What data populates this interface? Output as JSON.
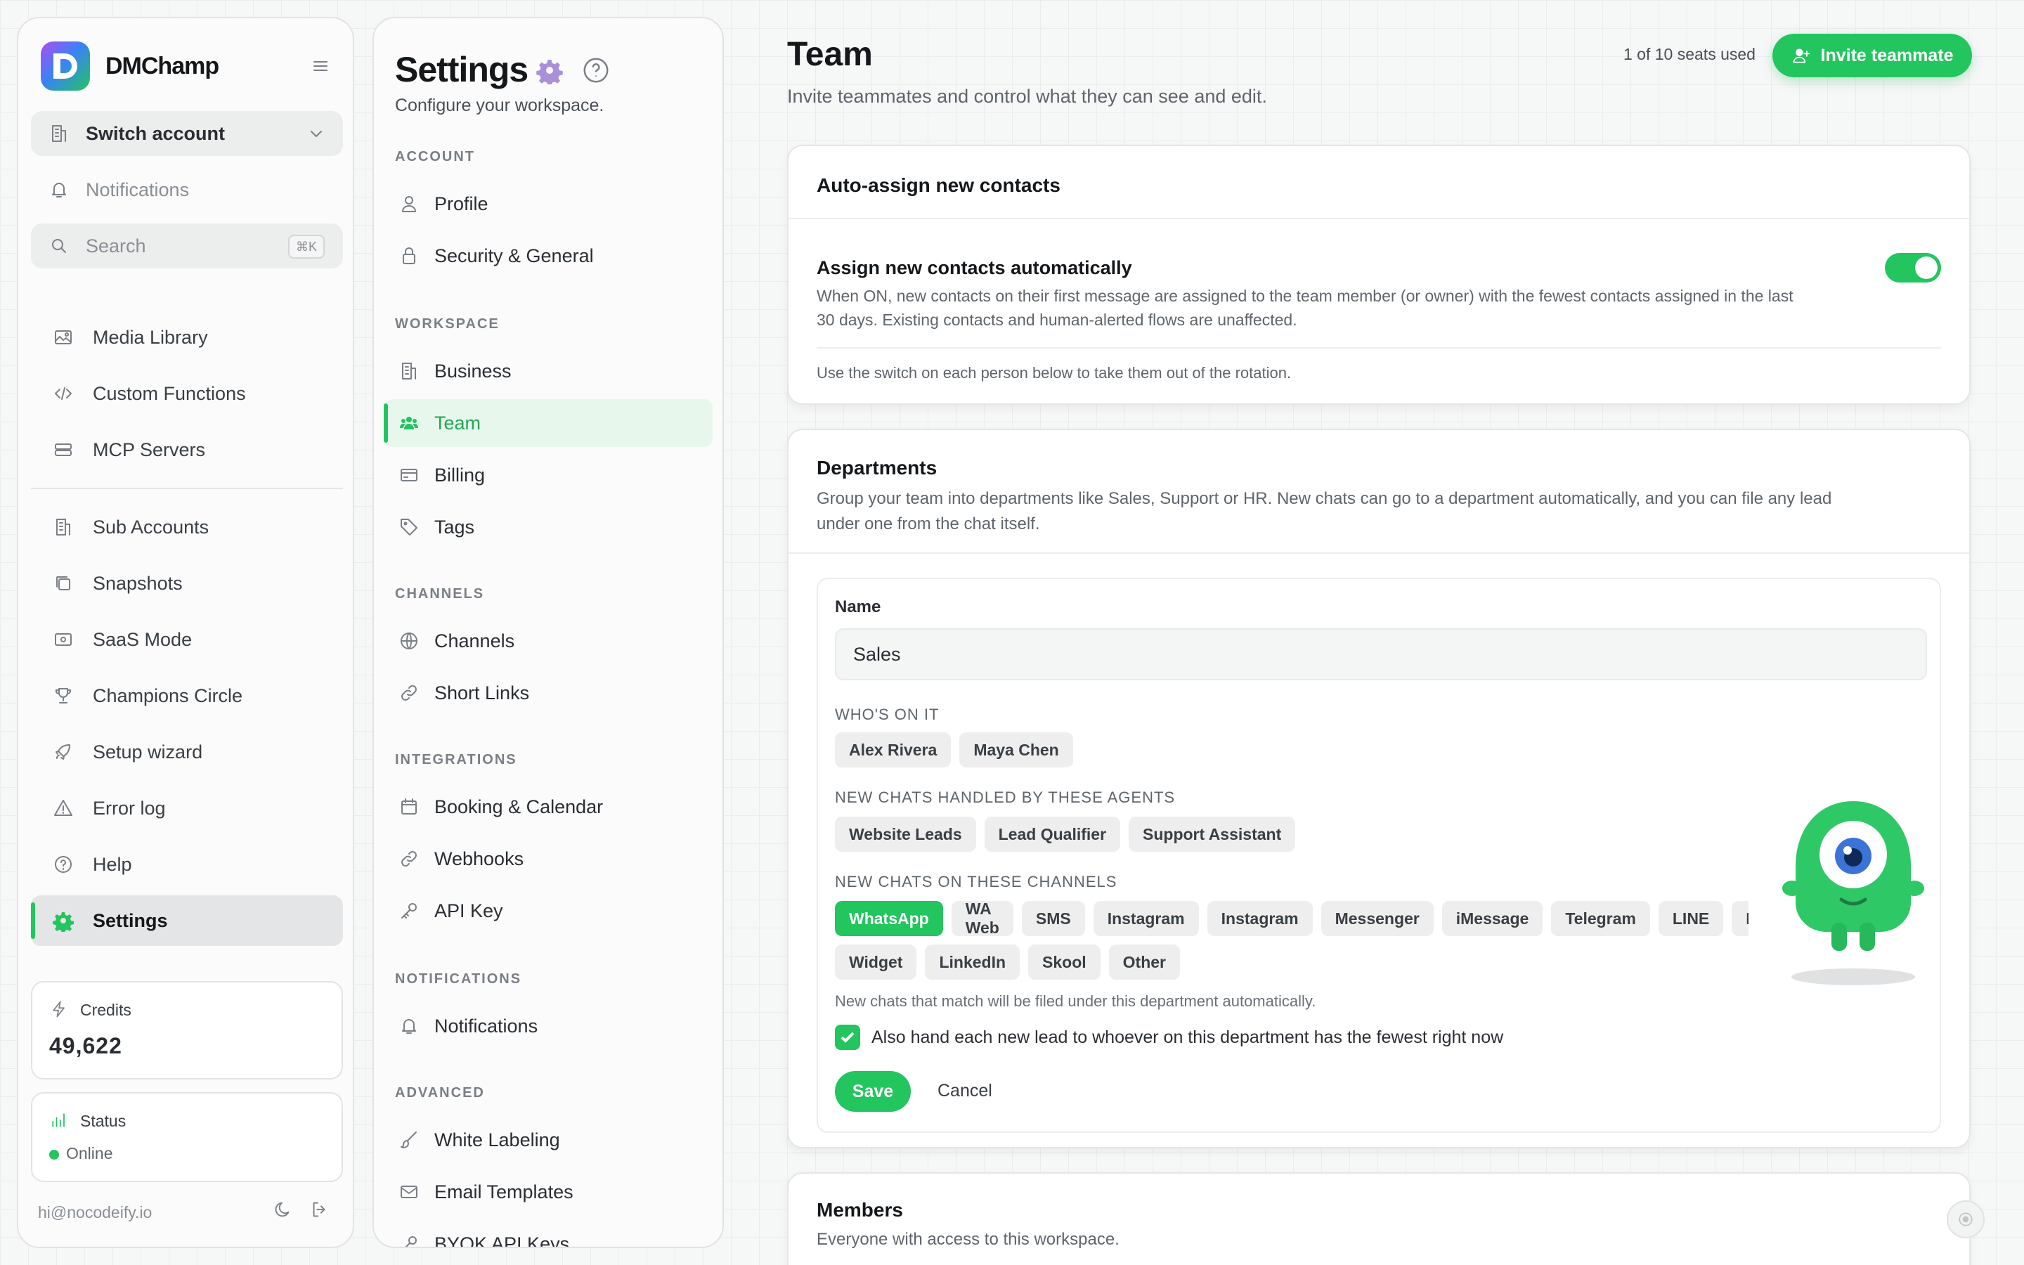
{
  "brand": {
    "name": "DMChamp"
  },
  "sidebar": {
    "switch_account": "Switch account",
    "notifications": "Notifications",
    "search": {
      "label": "Search",
      "shortcut": "⌘K"
    },
    "items": [
      {
        "label": "Media Library",
        "icon": "image-icon"
      },
      {
        "label": "Custom Functions",
        "icon": "code-icon"
      },
      {
        "label": "MCP Servers",
        "icon": "server-icon"
      },
      {
        "label": "Sub Accounts",
        "icon": "building-icon"
      },
      {
        "label": "Snapshots",
        "icon": "copy-icon"
      },
      {
        "label": "SaaS Mode",
        "icon": "wallet-icon"
      },
      {
        "label": "Champions Circle",
        "icon": "trophy-icon"
      },
      {
        "label": "Setup wizard",
        "icon": "rocket-icon"
      },
      {
        "label": "Error log",
        "icon": "warning-icon"
      },
      {
        "label": "Help",
        "icon": "help-icon"
      },
      {
        "label": "Settings",
        "icon": "gear-icon",
        "active": true
      }
    ],
    "credits": {
      "label": "Credits",
      "value": "49,622"
    },
    "status": {
      "label": "Status",
      "value": "Online"
    },
    "footer_email": "hi@nocodeify.io"
  },
  "settings_nav": {
    "title": "Settings",
    "subtitle": "Configure your workspace.",
    "sections": [
      {
        "title": "ACCOUNT",
        "items": [
          "Profile",
          "Security & General"
        ]
      },
      {
        "title": "WORKSPACE",
        "items": [
          "Business",
          "Team",
          "Billing",
          "Tags"
        ]
      },
      {
        "title": "CHANNELS",
        "items": [
          "Channels",
          "Short Links"
        ]
      },
      {
        "title": "INTEGRATIONS",
        "items": [
          "Booking & Calendar",
          "Webhooks",
          "API Key"
        ]
      },
      {
        "title": "NOTIFICATIONS",
        "items": [
          "Notifications"
        ]
      },
      {
        "title": "ADVANCED",
        "items": [
          "White Labeling",
          "Email Templates",
          "BYOK API Keys"
        ]
      }
    ],
    "active": "Team"
  },
  "main": {
    "title": "Team",
    "subtitle": "Invite teammates and control what they can see and edit.",
    "seats": "1 of 10 seats used",
    "invite_label": "Invite teammate",
    "auto_assign": {
      "title": "Auto-assign new contacts",
      "setting_title": "Assign new contacts automatically",
      "desc1": "When ON, new contacts on their first message are assigned to the team member (or owner) with the fewest contacts assigned in the last",
      "desc2": "30 days. Existing contacts and human-alerted flows are unaffected.",
      "note": "Use the switch on each person below to take them out of the rotation.",
      "enabled": true
    },
    "departments": {
      "title": "Departments",
      "desc1": "Group your team into departments like Sales, Support or HR. New chats can go to a department automatically, and you can file any lead",
      "desc2": "under one from the chat itself.",
      "name_label": "Name",
      "name_value": "Sales",
      "whos_on_it": "WHO'S ON IT",
      "members": [
        "Alex Rivera",
        "Maya Chen"
      ],
      "agents_label": "NEW CHATS HANDLED BY THESE AGENTS",
      "agents": [
        "Website Leads",
        "Lead Qualifier",
        "Support Assistant"
      ],
      "channels_label": "NEW CHATS ON THESE CHANNELS",
      "channels": [
        "WhatsApp",
        "WA Web",
        "SMS",
        "Instagram",
        "Instagram",
        "Messenger",
        "iMessage",
        "Telegram",
        "LINE",
        "Email"
      ],
      "channels_row2": [
        "Widget",
        "LinkedIn",
        "Skool",
        "Other"
      ],
      "selected_channel": "WhatsApp",
      "hint": "New chats that match will be filed under this department automatically.",
      "checkbox_label": "Also hand each new lead to whoever on this department has the fewest right now",
      "save": "Save",
      "cancel": "Cancel"
    },
    "members": {
      "title": "Members",
      "desc": "Everyone with access to this workspace."
    }
  },
  "colors": {
    "accent": "#22c55e",
    "accent_light": "#e7f7ec"
  }
}
